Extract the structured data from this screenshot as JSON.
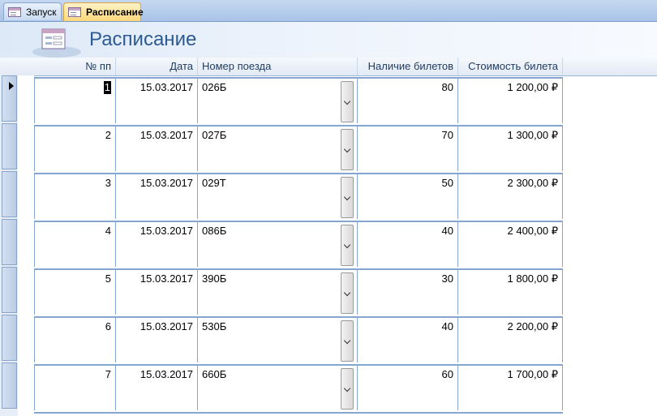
{
  "tabs": [
    {
      "label": "Запуск",
      "active": false
    },
    {
      "label": "Расписание",
      "active": true
    }
  ],
  "form": {
    "title": "Расписание"
  },
  "columns": {
    "num": "№ пп",
    "date": "Дата",
    "train": "Номер поезда",
    "availability": "Наличие билетов",
    "cost": "Стоимость билета"
  },
  "rows": [
    {
      "num": "1",
      "date": "15.03.2017",
      "train": "026Б",
      "availability": "80",
      "cost": "1 200,00 ₽"
    },
    {
      "num": "2",
      "date": "15.03.2017",
      "train": "027Б",
      "availability": "70",
      "cost": "1 300,00 ₽"
    },
    {
      "num": "3",
      "date": "15.03.2017",
      "train": "029Т",
      "availability": "50",
      "cost": "2 300,00 ₽"
    },
    {
      "num": "4",
      "date": "15.03.2017",
      "train": "086Б",
      "availability": "40",
      "cost": "2 400,00 ₽"
    },
    {
      "num": "5",
      "date": "15.03.2017",
      "train": "390Б",
      "availability": "30",
      "cost": "1 800,00 ₽"
    },
    {
      "num": "6",
      "date": "15.03.2017",
      "train": "530Б",
      "availability": "40",
      "cost": "2 200,00 ₽"
    },
    {
      "num": "7",
      "date": "15.03.2017",
      "train": "660Б",
      "availability": "60",
      "cost": "1 700,00 ₽"
    }
  ],
  "icons": {
    "tab_icon": "form-icon",
    "header_icon": "form-icon",
    "record_pointer": "current-record-arrow-icon",
    "dropdown": "chevron-down-icon"
  },
  "colors": {
    "title": "#2d5a92",
    "active_tab": "#ffd77a",
    "grid_lines": "#86a6d2"
  }
}
